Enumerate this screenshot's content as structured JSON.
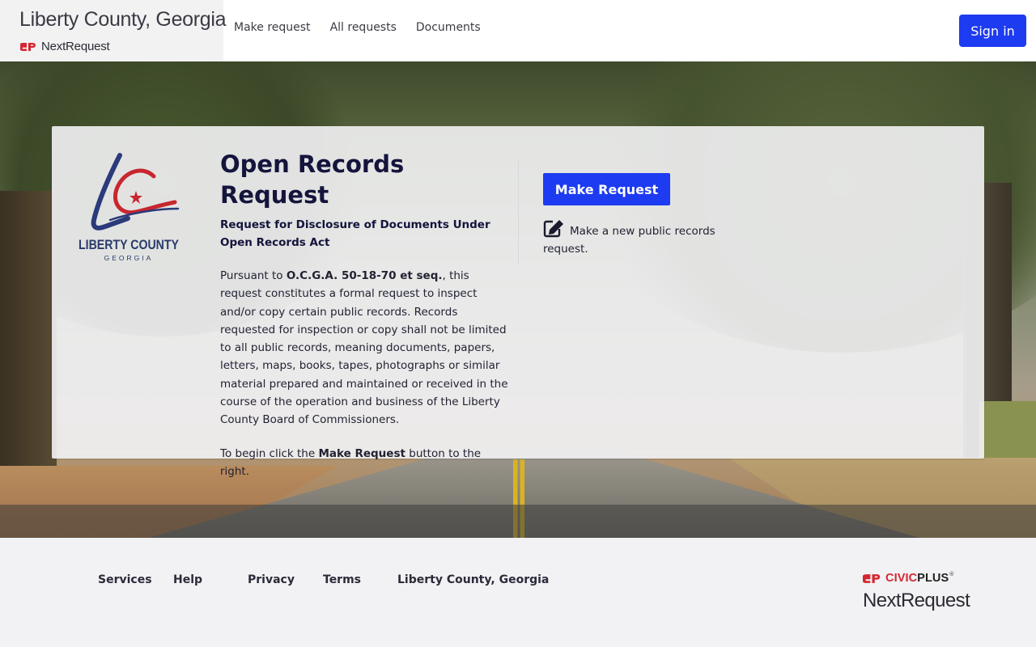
{
  "header": {
    "site_title": "Liberty County, Georgia",
    "logo_text": "NextRequest",
    "nav": [
      "Make request",
      "All requests",
      "Documents"
    ],
    "signin_label": "Sign in"
  },
  "card": {
    "title": "Open Records Request",
    "subtitle": "Request for Disclosure of Documents Under Open Records Act",
    "body_prefix": "Pursuant to ",
    "body_statute": "O.C.G.A. 50-18-70 et seq.",
    "body_rest": ", this request constitutes a formal request to inspect and/or copy certain public records. Records requested for inspection or copy shall not be limited to all public records, meaning documents, papers, letters, maps, books, tapes, photographs or similar material prepared and maintained or received in the course of the operation and business of the Liberty County Board of Commissioners.",
    "cta_prefix": "To begin click the ",
    "cta_bold": "Make Request",
    "cta_suffix": " button to the right.",
    "logo": {
      "name": "LIBERTY COUNTY",
      "state": "GEORGIA"
    }
  },
  "action": {
    "button_label": "Make Request",
    "description": "Make a new public records request.",
    "icon": "edit-icon"
  },
  "footer": {
    "links": [
      "Services",
      "Help",
      "Privacy",
      "Terms",
      "Liberty County, Georgia"
    ],
    "civicplus_civic": "CIVIC",
    "civicplus_plus": "PLUS",
    "civicplus_reg": "®",
    "product": "NextRequest"
  },
  "colors": {
    "primary": "#1d3bf0",
    "civicplus_red": "#d42731",
    "title_navy": "#14143c"
  }
}
